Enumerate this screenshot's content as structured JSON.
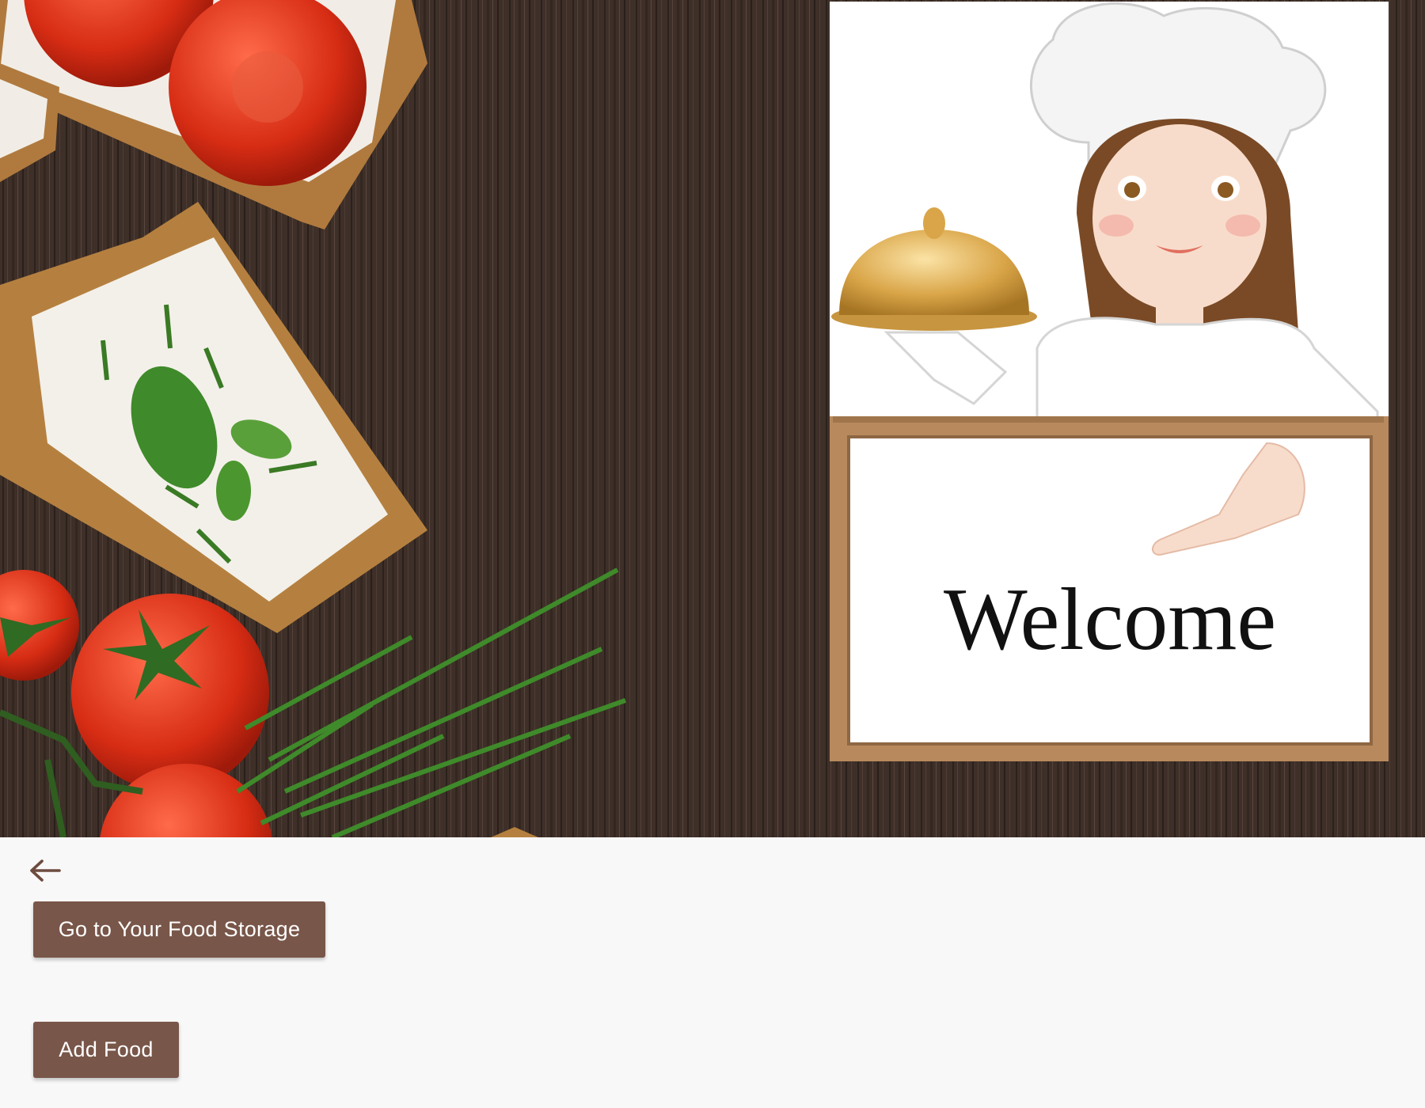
{
  "hero": {
    "sign_text": "Welcome"
  },
  "nav": {
    "back_icon": "arrow-left-icon"
  },
  "actions": {
    "storage_label": "Go to Your Food Storage",
    "add_food_label": "Add Food"
  },
  "colors": {
    "button": "#785649",
    "wood": "#3e2f28",
    "page_background": "#fafafa",
    "sign_frame": "#b8895c"
  }
}
